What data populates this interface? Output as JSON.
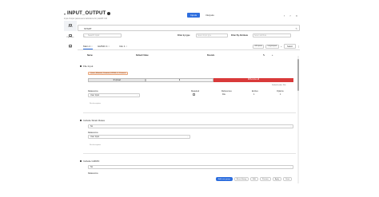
{
  "header": {
    "title": "INPUT_OUTPUT",
    "subtitle": "Input-Output parameters definitions for pwMAT-CM",
    "io_tabs": [
      "Inputs",
      "Outputs"
    ],
    "icons": [
      "close-icon",
      "back-icon",
      "add-icon"
    ]
  },
  "left_nav": {
    "items": [
      {
        "label": "Home",
        "icon": "home-icon"
      },
      {
        "label": "Pipelines",
        "icon": "pipeline-icon"
      },
      {
        "label": "Edit",
        "icon": "edit-icon"
      }
    ]
  },
  "path_field": {
    "value": "START",
    "edit_icon": "pencil-icon"
  },
  "filters": {
    "search_placeholder": "Search Input",
    "filter_type_label": "Filter by type",
    "filter_type_placeholder": "Select Input type",
    "filter_attr_label": "Filter By Attribute",
    "filter_attr_placeholder": "Select attribute"
  },
  "tabs": {
    "items": [
      {
        "label": "Main",
        "badge": "4"
      },
      {
        "label": "GIZMO",
        "badge": "4"
      },
      {
        "label": "Info",
        "badge": "1"
      }
    ],
    "right_pills": [
      "All inputs",
      "Ungrouped"
    ],
    "select_value": "Select"
  },
  "table_header": {
    "col1": "Name",
    "col2": "Default Value",
    "col3": "Bounds"
  },
  "file_input": {
    "title": "File Input",
    "file_tag": "Quasi_Material_Contrast_DPDM_3_11.vtm",
    "upload_label": "Upload",
    "remove_label": "Remove all",
    "default_link": "Default value: File"
  },
  "file_props": {
    "datasource_label": "Datasource",
    "datasource_value": "User Input",
    "required_label": "Required",
    "references_label": "References",
    "references_value": "File",
    "entries_label": "Entries",
    "entries_value": "1",
    "options_label": "Options",
    "options_value": "1",
    "no_description": "No description"
  },
  "strain_rates": {
    "title": "Include Strain Rates",
    "value": "No",
    "datasource_label": "Datasource",
    "datasource_value": "User Input",
    "no_description": "No description"
  },
  "gizmo": {
    "title": "Include GIZMO",
    "value": "No",
    "datasource_label": "Datasource"
  },
  "bottom_bar": {
    "buttons": [
      "Add new group",
      "Reset Group",
      "Edit",
      "Preview",
      "Apply",
      "Save"
    ]
  }
}
